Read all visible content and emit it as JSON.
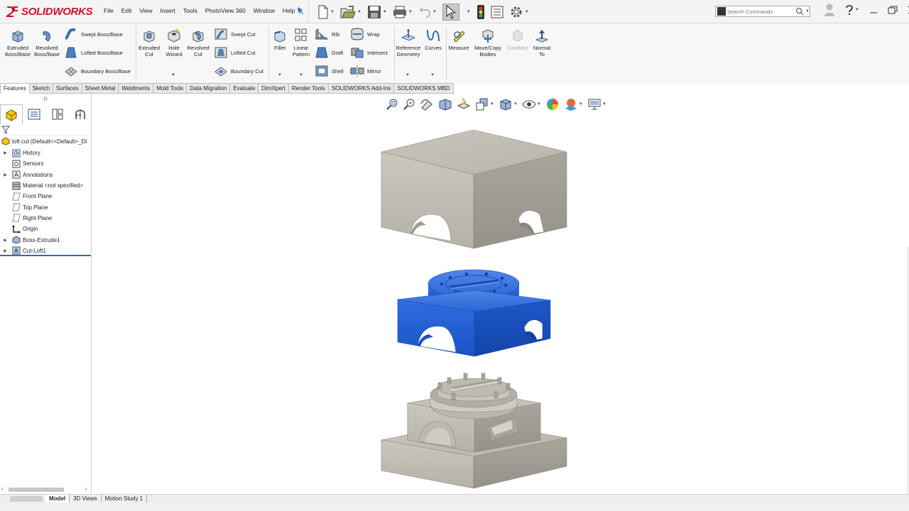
{
  "app": {
    "brand": "SOLIDWORKS",
    "menu": [
      "File",
      "Edit",
      "View",
      "Insert",
      "Tools",
      "PhotoView 360",
      "Window",
      "Help"
    ],
    "search_placeholder": "Search Commands"
  },
  "quick_access_icons": [
    "new-document-icon",
    "open-icon",
    "save-icon",
    "print-icon",
    "undo-icon",
    "select-cursor-icon",
    "rebuild-icon",
    "file-properties-icon",
    "options-gear-icon"
  ],
  "ribbon": {
    "extruded_boss": "Extruded\nBoss/Base",
    "revolved_boss": "Revolved\nBoss/Base",
    "swept_boss": "Swept Boss/Base",
    "lofted_boss": "Lofted Boss/Base",
    "boundary_boss": "Boundary Boss/Base",
    "extruded_cut": "Extruded\nCut",
    "hole_wizard": "Hole\nWizard",
    "revolved_cut": "Revolved\nCut",
    "swept_cut": "Swept Cut",
    "lofted_cut": "Lofted Cut",
    "boundary_cut": "Boundary Cut",
    "fillet": "Fillet",
    "linear_pattern": "Linear\nPattern",
    "rib": "Rib",
    "draft": "Draft",
    "shell": "Shell",
    "wrap": "Wrap",
    "intersect": "Intersect",
    "mirror": "Mirror",
    "reference_geometry": "Reference\nGeometry",
    "curves": "Curves",
    "measure": "Measure",
    "move_copy": "Move/Copy\nBodies",
    "combine": "Combine",
    "normal_to": "Normal\nTo"
  },
  "tabs": [
    "Features",
    "Sketch",
    "Surfaces",
    "Sheet Metal",
    "Weldments",
    "Mold Tools",
    "Data Migration",
    "Evaluate",
    "DimXpert",
    "Render Tools",
    "SOLIDWORKS Add-Ins",
    "SOLIDWORKS MBD"
  ],
  "active_tab": "Features",
  "feature_tree": {
    "root": "loft cut  (Default<<Default>_Di",
    "items": [
      {
        "label": "History",
        "expandable": true,
        "icon": "history-folder-icon"
      },
      {
        "label": "Sensors",
        "expandable": false,
        "icon": "sensors-icon"
      },
      {
        "label": "Annotations",
        "expandable": true,
        "icon": "annotations-icon"
      },
      {
        "label": "Material <not specified>",
        "expandable": false,
        "icon": "material-icon"
      },
      {
        "label": "Front Plane",
        "expandable": false,
        "icon": "plane-icon"
      },
      {
        "label": "Top Plane",
        "expandable": false,
        "icon": "plane-icon"
      },
      {
        "label": "Right Plane",
        "expandable": false,
        "icon": "plane-icon"
      },
      {
        "label": "Origin",
        "expandable": false,
        "icon": "origin-icon"
      },
      {
        "label": "Boss-Extrude1",
        "expandable": true,
        "icon": "boss-extrude-icon"
      },
      {
        "label": "Cut-Loft1",
        "expandable": true,
        "icon": "cut-loft-icon"
      }
    ]
  },
  "bottom_tabs": [
    "Model",
    "3D Views",
    "Motion Study 1"
  ],
  "active_bottom_tab": "Model",
  "colors": {
    "brand_red": "#d1112b",
    "part_blue": "#1e5fd6",
    "part_gray": "#bdb8ad",
    "rollback_bar": "#3a67b4"
  }
}
